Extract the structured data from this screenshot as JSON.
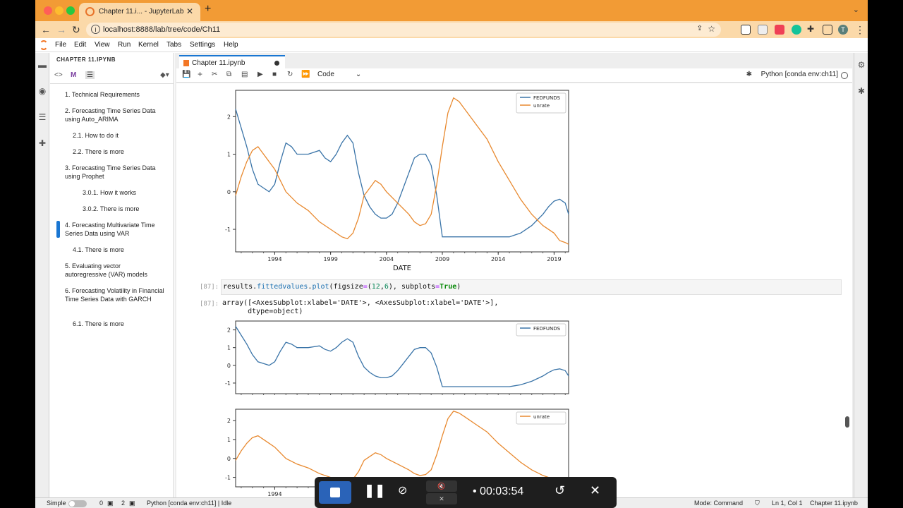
{
  "browser": {
    "tab_title": "Chapter 11.i... - JupyterLab",
    "url": "localhost:8888/lab/tree/code/Ch11",
    "profile_initial": "T"
  },
  "menu": {
    "items": [
      "File",
      "Edit",
      "View",
      "Run",
      "Kernel",
      "Tabs",
      "Settings",
      "Help"
    ]
  },
  "toc": {
    "title": "CHAPTER 11.IPYNB",
    "items": [
      "1. Technical Requirements",
      "2. Forecasting Time Series Data using Auto_ARIMA",
      "2.1. How to do it",
      "2.2. There is more",
      "3. Forecasting Time Series Data using Prophet",
      "3.0.1. How it works",
      "3.0.2. There is more",
      "4. Forecasting Multivariate Time Series Data using VAR",
      "4.1. There is more",
      "5. Evaluating vector autoregressive (VAR) models",
      "6. Forecasting Volatility in Financial Time Series Data with GARCH",
      "6.1. There is more"
    ]
  },
  "notebook": {
    "tab_title": "Chapter 11.ipynb",
    "cell_type": "Code",
    "kernel": "Python [conda env:ch11]",
    "cell_prompt": "[87]:",
    "code_parts": [
      "results.",
      "fittedvalues",
      ".",
      "plot",
      "(figsize",
      "=",
      "(",
      "12",
      ",",
      "6",
      "), subplots",
      "=",
      "True",
      ")"
    ],
    "output_text": "array([<AxesSubplot:xlabel='DATE'>, <AxesSubplot:xlabel='DATE'>],\n      dtype=object)"
  },
  "colors": {
    "fedfunds": "#3a74a8",
    "unrate": "#e8892f"
  },
  "status": {
    "mode_label": "Simple",
    "terminals": "0",
    "kernels": "2",
    "kernel_status": "Python [conda env:ch11] | Idle",
    "mode": "Mode: Command",
    "position": "Ln 1, Col 1",
    "filename": "Chapter 11.ipynb"
  },
  "recorder": {
    "time": "00:03:54"
  },
  "chart_data": [
    {
      "type": "line",
      "xlabel": "DATE",
      "xticks": [
        "1994",
        "1999",
        "2004",
        "2009",
        "2014",
        "2019"
      ],
      "yticks": [
        "-1",
        "0",
        "1",
        "2"
      ],
      "ylim": [
        -1.6,
        2.7
      ],
      "xlim": [
        1990.5,
        2020.3
      ],
      "legend": "top-right",
      "series": [
        {
          "name": "FEDFUNDS",
          "x": [
            1990.5,
            1991.0,
            1991.5,
            1992.0,
            1992.5,
            1993.0,
            1993.5,
            1994.0,
            1994.5,
            1995.0,
            1995.5,
            1996.0,
            1997.0,
            1998.0,
            1998.5,
            1999.0,
            1999.5,
            2000.0,
            2000.5,
            2001.0,
            2001.5,
            2002.0,
            2002.5,
            2003.0,
            2003.5,
            2004.0,
            2004.5,
            2005.0,
            2005.5,
            2006.0,
            2006.5,
            2007.0,
            2007.5,
            2008.0,
            2008.5,
            2009.0,
            2010.0,
            2012.0,
            2014.0,
            2015.0,
            2015.5,
            2016.0,
            2017.0,
            2018.0,
            2018.5,
            2019.0,
            2019.5,
            2020.0,
            2020.3
          ],
          "values": [
            2.2,
            1.7,
            1.2,
            0.6,
            0.2,
            0.1,
            0.0,
            0.2,
            0.8,
            1.3,
            1.2,
            1.0,
            1.0,
            1.1,
            0.9,
            0.8,
            1.0,
            1.3,
            1.5,
            1.3,
            0.5,
            -0.1,
            -0.4,
            -0.6,
            -0.7,
            -0.7,
            -0.6,
            -0.3,
            0.1,
            0.5,
            0.9,
            1.0,
            1.0,
            0.7,
            -0.1,
            -1.2,
            -1.2,
            -1.2,
            -1.2,
            -1.2,
            -1.15,
            -1.1,
            -0.9,
            -0.6,
            -0.4,
            -0.25,
            -0.2,
            -0.3,
            -0.6
          ]
        },
        {
          "name": "unrate",
          "x": [
            1990.5,
            1991.0,
            1991.5,
            1992.0,
            1992.5,
            1993.0,
            1993.5,
            1994.0,
            1995.0,
            1996.0,
            1997.0,
            1998.0,
            1999.0,
            2000.0,
            2000.5,
            2001.0,
            2001.5,
            2002.0,
            2002.5,
            2003.0,
            2003.5,
            2004.0,
            2005.0,
            2006.0,
            2006.5,
            2007.0,
            2007.5,
            2008.0,
            2008.5,
            2009.0,
            2009.5,
            2010.0,
            2010.5,
            2011.0,
            2012.0,
            2013.0,
            2014.0,
            2015.0,
            2016.0,
            2017.0,
            2018.0,
            2019.0,
            2019.5,
            2020.0,
            2020.3
          ],
          "values": [
            -0.1,
            0.4,
            0.8,
            1.1,
            1.2,
            1.0,
            0.8,
            0.6,
            0.0,
            -0.3,
            -0.5,
            -0.8,
            -1.0,
            -1.2,
            -1.25,
            -1.1,
            -0.7,
            -0.1,
            0.1,
            0.3,
            0.2,
            0.0,
            -0.3,
            -0.6,
            -0.8,
            -0.9,
            -0.85,
            -0.6,
            0.2,
            1.2,
            2.1,
            2.5,
            2.4,
            2.2,
            1.8,
            1.4,
            0.8,
            0.3,
            -0.2,
            -0.6,
            -0.9,
            -1.1,
            -1.3,
            -1.35,
            -1.4
          ]
        }
      ]
    },
    {
      "type": "line",
      "yticks": [
        "-1",
        "0",
        "1",
        "2"
      ],
      "ylim": [
        -1.6,
        2.5
      ],
      "xlim": [
        1990.5,
        2020.3
      ],
      "legend": "top-right",
      "series": [
        {
          "name": "FEDFUNDS",
          "x": [
            1990.5,
            1991.0,
            1991.5,
            1992.0,
            1992.5,
            1993.0,
            1993.5,
            1994.0,
            1994.5,
            1995.0,
            1995.5,
            1996.0,
            1997.0,
            1998.0,
            1998.5,
            1999.0,
            1999.5,
            2000.0,
            2000.5,
            2001.0,
            2001.5,
            2002.0,
            2002.5,
            2003.0,
            2003.5,
            2004.0,
            2004.5,
            2005.0,
            2005.5,
            2006.0,
            2006.5,
            2007.0,
            2007.5,
            2008.0,
            2008.5,
            2009.0,
            2010.0,
            2012.0,
            2014.0,
            2015.0,
            2015.5,
            2016.0,
            2017.0,
            2018.0,
            2018.5,
            2019.0,
            2019.5,
            2020.0,
            2020.3
          ],
          "values": [
            2.2,
            1.7,
            1.2,
            0.6,
            0.2,
            0.1,
            0.0,
            0.2,
            0.8,
            1.3,
            1.2,
            1.0,
            1.0,
            1.1,
            0.9,
            0.8,
            1.0,
            1.3,
            1.5,
            1.3,
            0.5,
            -0.1,
            -0.4,
            -0.6,
            -0.7,
            -0.7,
            -0.6,
            -0.3,
            0.1,
            0.5,
            0.9,
            1.0,
            1.0,
            0.7,
            -0.1,
            -1.2,
            -1.2,
            -1.2,
            -1.2,
            -1.2,
            -1.15,
            -1.1,
            -0.9,
            -0.6,
            -0.4,
            -0.25,
            -0.2,
            -0.3,
            -0.6
          ]
        }
      ]
    },
    {
      "type": "line",
      "xticks": [
        "1994"
      ],
      "yticks": [
        "-1",
        "0",
        "1",
        "2"
      ],
      "ylim": [
        -1.5,
        2.6
      ],
      "xlim": [
        1990.5,
        2020.3
      ],
      "legend": "top-right",
      "series": [
        {
          "name": "unrate",
          "x": [
            1990.5,
            1991.0,
            1991.5,
            1992.0,
            1992.5,
            1993.0,
            1993.5,
            1994.0,
            1995.0,
            1996.0,
            1997.0,
            1998.0,
            1999.0,
            2000.0,
            2000.5,
            2001.0,
            2001.5,
            2002.0,
            2002.5,
            2003.0,
            2003.5,
            2004.0,
            2005.0,
            2006.0,
            2006.5,
            2007.0,
            2007.5,
            2008.0,
            2008.5,
            2009.0,
            2009.5,
            2010.0,
            2010.5,
            2011.0,
            2012.0,
            2013.0,
            2014.0,
            2015.0,
            2016.0,
            2017.0,
            2018.0,
            2019.0,
            2019.5,
            2020.0,
            2020.3
          ],
          "values": [
            -0.1,
            0.4,
            0.8,
            1.1,
            1.2,
            1.0,
            0.8,
            0.6,
            0.0,
            -0.3,
            -0.5,
            -0.8,
            -1.0,
            -1.2,
            -1.25,
            -1.1,
            -0.7,
            -0.1,
            0.1,
            0.3,
            0.2,
            0.0,
            -0.3,
            -0.6,
            -0.8,
            -0.9,
            -0.85,
            -0.6,
            0.2,
            1.2,
            2.1,
            2.5,
            2.4,
            2.2,
            1.8,
            1.4,
            0.8,
            0.3,
            -0.2,
            -0.6,
            -0.9,
            -1.1,
            -1.3,
            -1.35,
            -1.4
          ]
        }
      ]
    }
  ]
}
